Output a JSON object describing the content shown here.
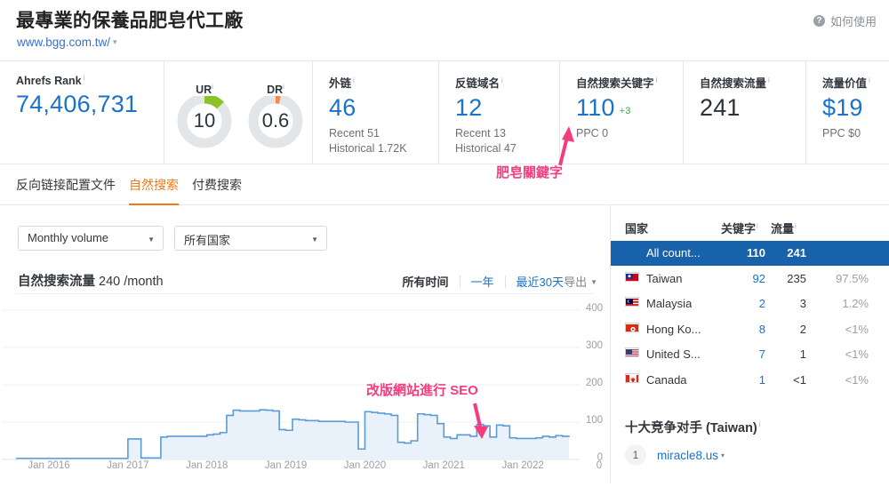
{
  "header": {
    "title": "最專業的保養品肥皂代工廠",
    "url": "www.bgg.com.tw/",
    "url_caret": "▾",
    "help_label": "如何使用",
    "help_icon": "question-mark-icon"
  },
  "metrics": [
    {
      "label": "Ahrefs Rank",
      "sup": "i",
      "value": "74,406,731",
      "sub": []
    },
    {
      "label": "UR",
      "sup": "i",
      "value": "10",
      "gauge_color": "#8cc229"
    },
    {
      "label": "DR",
      "sup": "i",
      "value": "0.6",
      "gauge_color": "#f58a4b"
    },
    {
      "label": "外链",
      "sup": "i",
      "value": "46",
      "sub": [
        "Recent 51",
        "Historical 1.72K"
      ]
    },
    {
      "label": "反链域名",
      "sup": "i",
      "value": "12",
      "sub": [
        "Recent 13",
        "Historical 47"
      ]
    },
    {
      "label": "自然搜索关键字",
      "sup": "i",
      "value": "110",
      "delta": "+3",
      "sub": [
        "PPC 0"
      ]
    },
    {
      "label": "自然搜索流量",
      "sup": "i",
      "value": "241",
      "dark": true,
      "sub": []
    },
    {
      "label": "流量价值",
      "sup": "i",
      "value": "$19",
      "sub": [
        "PPC $0"
      ]
    }
  ],
  "tabs": [
    {
      "label": "反向链接配置文件",
      "active": false
    },
    {
      "label": "自然搜索",
      "active": true
    },
    {
      "label": "付费搜索",
      "active": false
    }
  ],
  "filters": [
    {
      "value": "Monthly volume",
      "caret": "▼"
    },
    {
      "value": "所有国家",
      "caret": "▼"
    }
  ],
  "chart_header": {
    "title": "自然搜索流量",
    "value": "240",
    "unit": "/month",
    "ranges": [
      {
        "label": "所有时间",
        "active": true
      },
      {
        "label": "一年",
        "active": false
      },
      {
        "label": "最近30天",
        "active": false
      }
    ],
    "export_label": "导出",
    "export_caret": "▼"
  },
  "annotations": [
    {
      "text": "肥皂關鍵字",
      "color": "#f53d7e"
    },
    {
      "text": "改版網站進行 SEO",
      "color": "#f53d7e"
    }
  ],
  "countries_table": {
    "columns": [
      {
        "label": "国家",
        "sup": ""
      },
      {
        "label": "关键字",
        "sup": "i"
      },
      {
        "label": "流量",
        "sup": "i"
      }
    ],
    "rows": [
      {
        "name": "All count...",
        "keywords": "110",
        "traffic": "241",
        "percent": "",
        "flag": "",
        "selected": true
      },
      {
        "name": "Taiwan",
        "keywords": "92",
        "traffic": "235",
        "percent": "97.5%",
        "flag": "tw",
        "selected": false
      },
      {
        "name": "Malaysia",
        "keywords": "2",
        "traffic": "3",
        "percent": "1.2%",
        "flag": "my",
        "selected": false
      },
      {
        "name": "Hong Ko...",
        "keywords": "8",
        "traffic": "2",
        "percent": "<1%",
        "flag": "hk",
        "selected": false
      },
      {
        "name": "United S...",
        "keywords": "7",
        "traffic": "1",
        "percent": "<1%",
        "flag": "us",
        "selected": false
      },
      {
        "name": "Canada",
        "keywords": "1",
        "traffic": "<1",
        "percent": "<1%",
        "flag": "ca",
        "selected": false
      }
    ]
  },
  "competitors": {
    "title": "十大竞争对手 (Taiwan)",
    "sup": "i",
    "rows": [
      {
        "index": "1",
        "domain": "miracle8.us",
        "caret": "▾"
      }
    ]
  },
  "chart_data": {
    "type": "area",
    "title": "自然搜索流量",
    "xlabel": "",
    "ylabel": "",
    "ylim": [
      0,
      400
    ],
    "yticks": [
      0,
      100,
      200,
      300,
      400
    ],
    "xtick_labels": [
      "Jan 2016",
      "Jan 2017",
      "Jan 2018",
      "Jan 2019",
      "Jan 2020",
      "Jan 2021",
      "Jan 2022"
    ],
    "grid": true,
    "line_color": "#5b9bd5",
    "fill_color": "#e8f0fb",
    "series": [
      {
        "name": "Organic traffic",
        "x": [
          "2015-08",
          "2015-09",
          "2015-10",
          "2015-11",
          "2015-12",
          "2016-01",
          "2016-02",
          "2016-03",
          "2016-04",
          "2016-05",
          "2016-06",
          "2016-07",
          "2016-08",
          "2016-09",
          "2016-10",
          "2016-11",
          "2016-12",
          "2017-01",
          "2017-02",
          "2017-03",
          "2017-04",
          "2017-05",
          "2017-06",
          "2017-07",
          "2017-08",
          "2017-09",
          "2017-10",
          "2017-11",
          "2017-12",
          "2018-01",
          "2018-02",
          "2018-03",
          "2018-04",
          "2018-05",
          "2018-06",
          "2018-07",
          "2018-08",
          "2018-09",
          "2018-10",
          "2018-11",
          "2018-12",
          "2019-01",
          "2019-02",
          "2019-03",
          "2019-04",
          "2019-05",
          "2019-06",
          "2019-07",
          "2019-08",
          "2019-09",
          "2019-10",
          "2019-11",
          "2019-12",
          "2020-01",
          "2020-02",
          "2020-03",
          "2020-04",
          "2020-05",
          "2020-06",
          "2020-07",
          "2020-08",
          "2020-09",
          "2020-10",
          "2020-11",
          "2020-12",
          "2021-01",
          "2021-02",
          "2021-03",
          "2021-04",
          "2021-05",
          "2021-06",
          "2021-07",
          "2021-08",
          "2021-09",
          "2021-10",
          "2021-11",
          "2021-12",
          "2022-01",
          "2022-02",
          "2022-03",
          "2022-04",
          "2022-05",
          "2022-06",
          "2022-07",
          "2022-08"
        ],
        "values": [
          3,
          3,
          3,
          3,
          3,
          3,
          3,
          3,
          3,
          3,
          3,
          3,
          3,
          3,
          3,
          3,
          3,
          55,
          55,
          4,
          4,
          4,
          60,
          62,
          62,
          62,
          62,
          62,
          62,
          66,
          68,
          72,
          118,
          132,
          130,
          130,
          130,
          133,
          132,
          130,
          80,
          78,
          108,
          106,
          104,
          104,
          102,
          102,
          102,
          102,
          100,
          100,
          28,
          128,
          126,
          124,
          122,
          118,
          46,
          44,
          50,
          122,
          120,
          118,
          96,
          60,
          56,
          66,
          66,
          62,
          94,
          90,
          60,
          92,
          90,
          58,
          56,
          56,
          56,
          58,
          62,
          60,
          64,
          62,
          64
        ]
      }
    ]
  }
}
